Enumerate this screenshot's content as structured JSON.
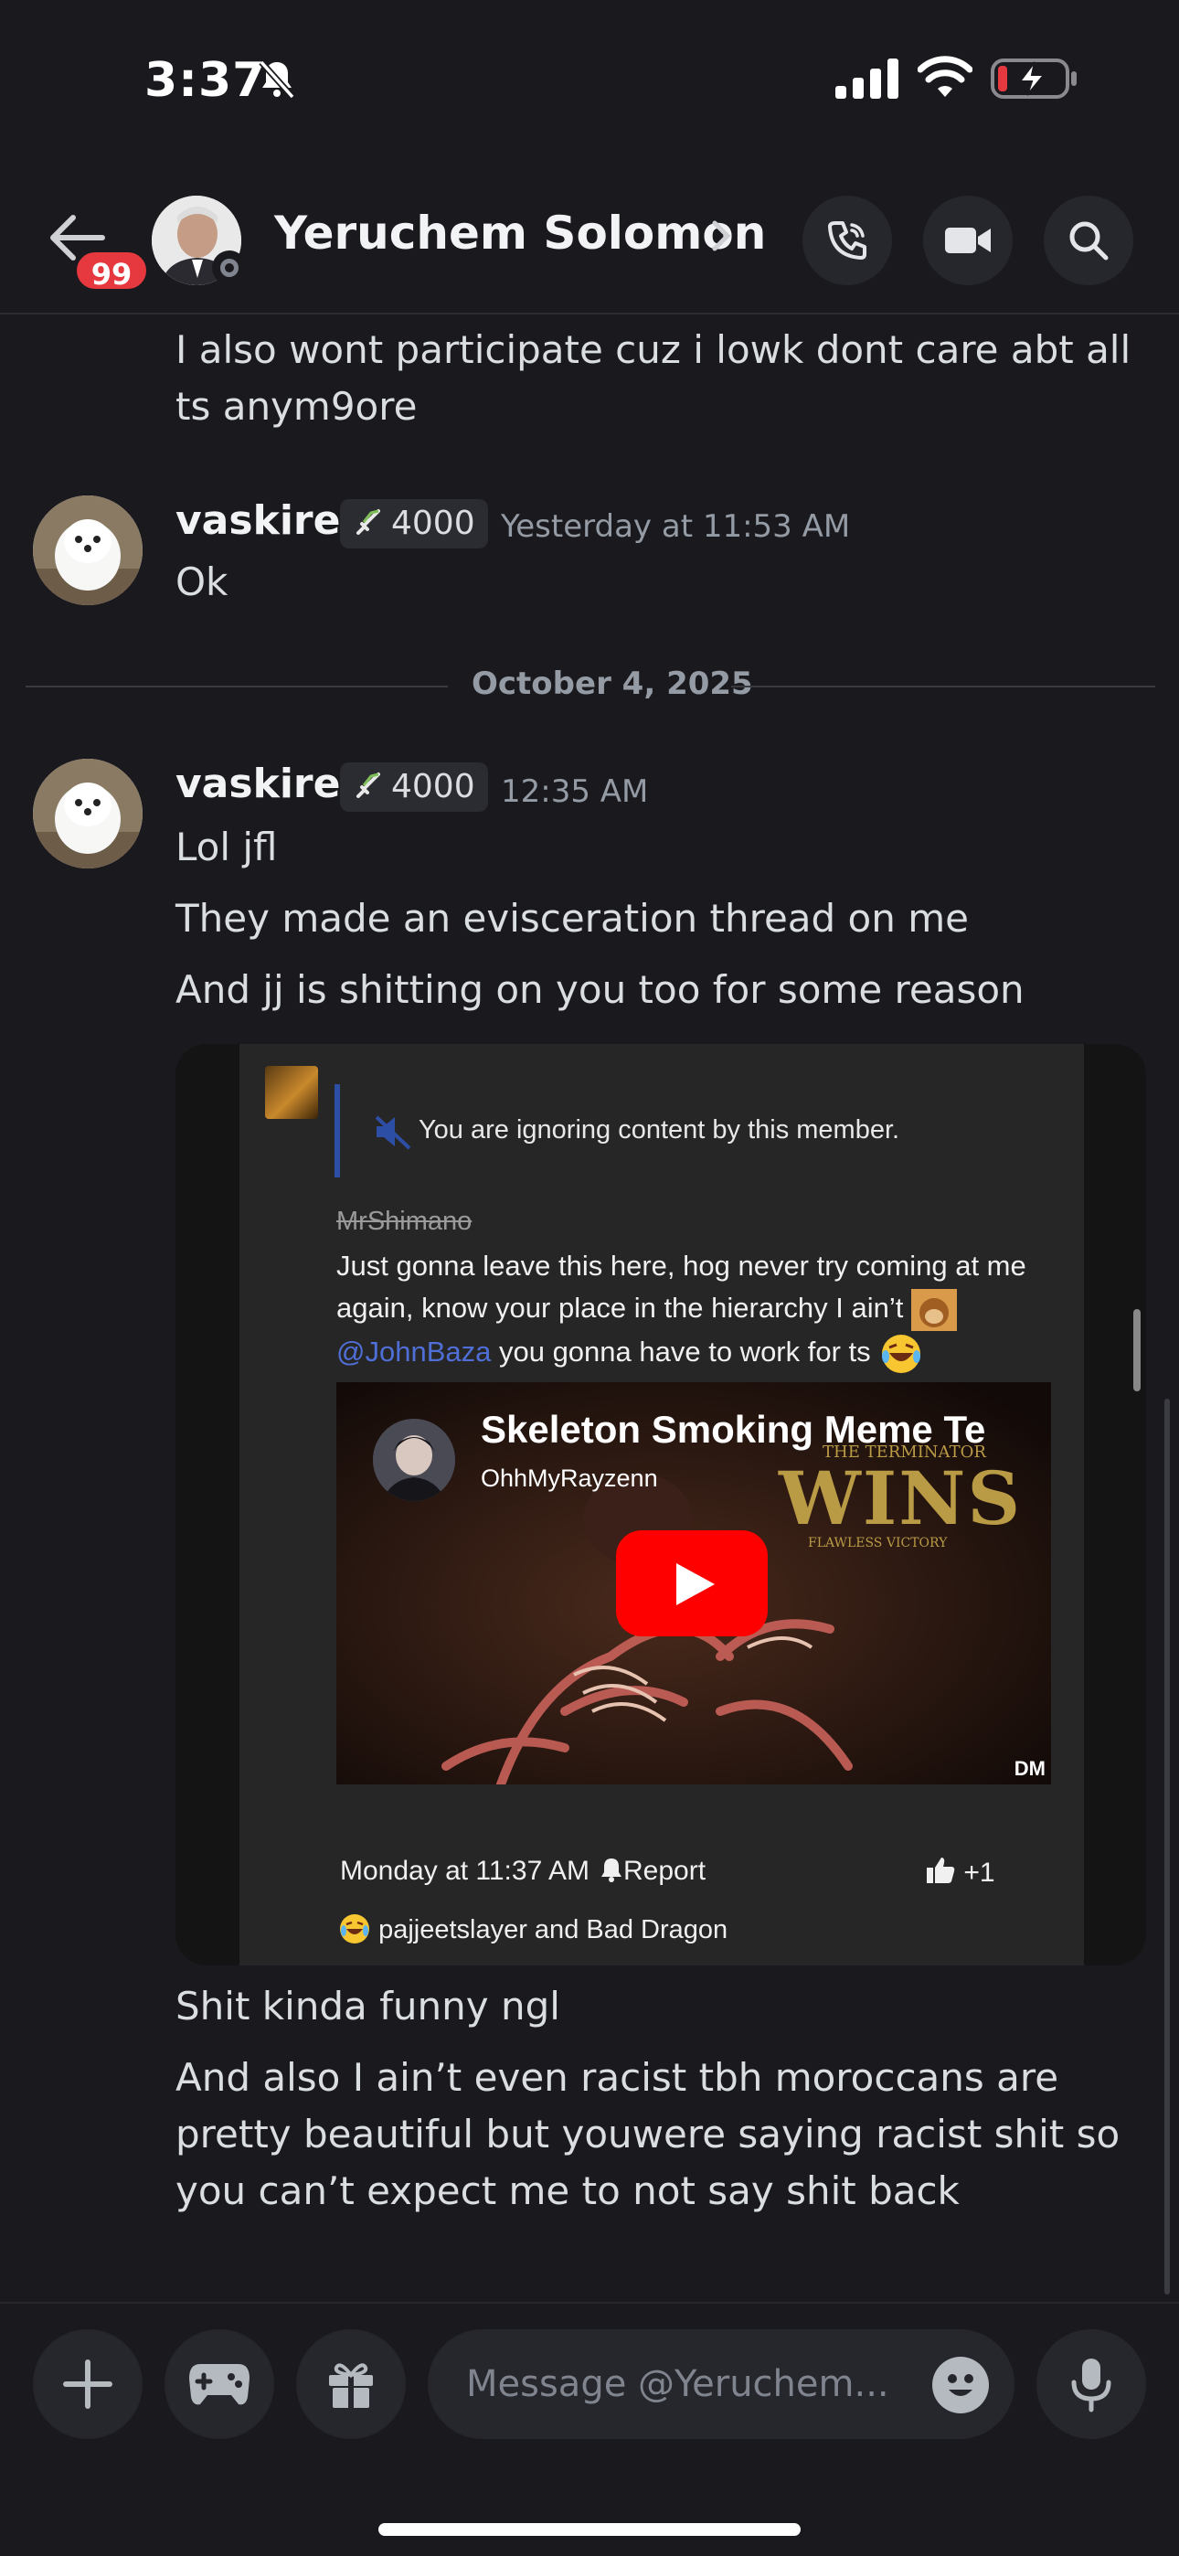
{
  "status_bar": {
    "time": "3:37"
  },
  "header": {
    "unread_badge": "99",
    "contact_name": "Yeruchem Solomon"
  },
  "messages": {
    "prev_continuation": "I also wont participate cuz i lowk dont care abt all ts anym9ore",
    "group1": {
      "username": "vaskiret",
      "tag": "4000",
      "timestamp": "Yesterday at 11:53 AM",
      "lines": [
        "Ok"
      ]
    },
    "date_divider": "October 4, 2025",
    "group2": {
      "username": "vaskiret",
      "tag": "4000",
      "timestamp": "12:35 AM",
      "lines": [
        "Lol jfl",
        "They made an evisceration thread on me",
        "And jj is shitting on you too for some reason"
      ]
    },
    "after_image": [
      "Shit kinda funny ngl",
      "And also I ain’t even racist tbh moroccans are pretty beautiful but youwere  saying racist shit so you can’t expect me to not say shit back"
    ]
  },
  "embedded_screenshot": {
    "ignore_notice": "You are ignoring content by this member.",
    "quoted_user": "MrShimano",
    "body_line1": "Just gonna leave this here, hog never try coming at me again, know your place in the hierarchy I ain’t",
    "mention": "@JohnBaza",
    "body_line2": " you gonna have to work for ts",
    "video": {
      "title": "Skeleton Smoking Meme Te",
      "channel": "OhhMyRayzenn",
      "overlay_small": "THE TERMINATOR",
      "overlay_big": "WINS",
      "overlay_sub": "FLAWLESS VICTORY",
      "corner_mark": "DM"
    },
    "post_time": "Monday at 11:37 AM",
    "report": "Report",
    "likes": "+1",
    "reactions": "pajjeetslayer and Bad Dragon"
  },
  "composer": {
    "placeholder": "Message @Yeruchem..."
  },
  "colors": {
    "background": "#1a1a1e",
    "badge_red": "#e5393f",
    "mention_blue": "#4f6fd6",
    "youtube_red": "#ff0000"
  }
}
